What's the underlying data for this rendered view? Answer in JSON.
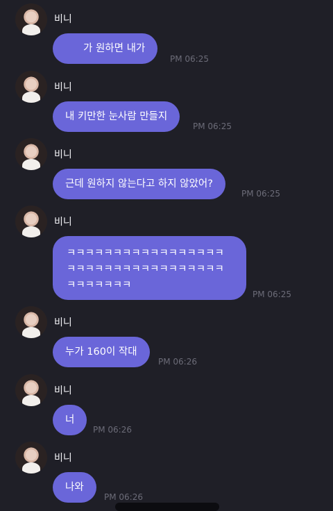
{
  "sender_name": "비니",
  "messages": [
    {
      "text": "가 원하면 내가",
      "time": "PM 06:25"
    },
    {
      "text": "내 키만한 눈사람 만들지",
      "time": "PM 06:25"
    },
    {
      "text": "근데 원하지 않는다고 하지 않았어?",
      "time": "PM 06:25"
    },
    {
      "text": "ㅋㅋㅋㅋㅋㅋㅋㅋㅋㅋㅋㅋㅋㅋㅋㅋㅋㅋㅋㅋㅋㅋㅋㅋㅋㅋㅋㅋㅋㅋㅋㅋㅋㅋㅋㅋㅋㅋㅋㅋㅋ",
      "time": "PM 06:25"
    },
    {
      "text": "누가 160이 작대",
      "time": "PM 06:26"
    },
    {
      "text": "너",
      "time": "PM 06:26"
    },
    {
      "text": "나와",
      "time": "PM 06:26"
    }
  ]
}
